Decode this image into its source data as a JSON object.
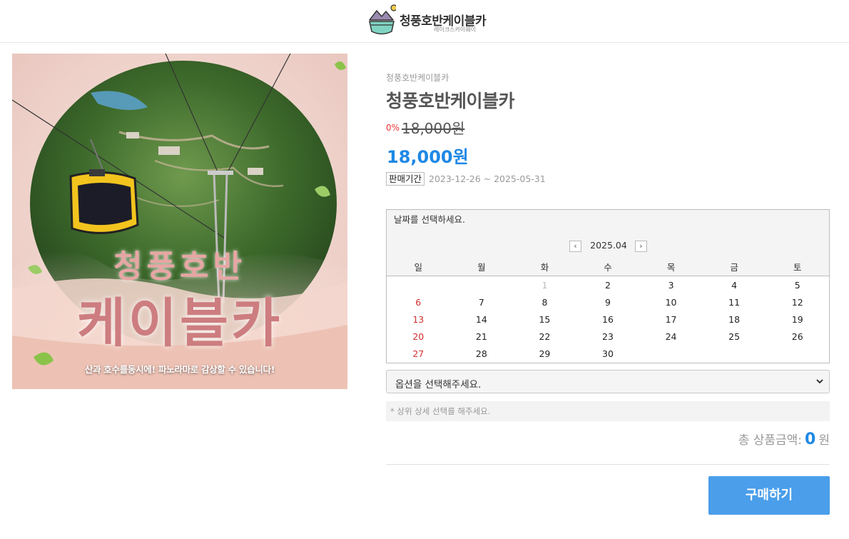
{
  "header": {
    "brand": "청풍호반케이블카",
    "brand_sub": "레이크스카이웨이"
  },
  "product_image": {
    "title_line1": "청풍호반",
    "title_line2": "케이블카",
    "caption": "산과 호수를동시에! 파노라마로 감상할 수 있습니다!"
  },
  "product": {
    "category": "청풍호반케이블카",
    "name": "청풍호반케이블카",
    "discount": "0%",
    "original_price": "18,000원",
    "sale_price": "18,000원",
    "period_label": "판매기간",
    "period_value": "2023-12-26 ~ 2025-05-31"
  },
  "calendar": {
    "prompt": "날짜를 선택하세요.",
    "prev_label": "‹",
    "next_label": "›",
    "month": "2025.04",
    "weekdays": [
      "일",
      "월",
      "화",
      "수",
      "목",
      "금",
      "토"
    ],
    "days": [
      "",
      "",
      "1",
      "2",
      "3",
      "4",
      "5",
      "6",
      "7",
      "8",
      "9",
      "10",
      "11",
      "12",
      "13",
      "14",
      "15",
      "16",
      "17",
      "18",
      "19",
      "20",
      "21",
      "22",
      "23",
      "24",
      "25",
      "26",
      "27",
      "28",
      "29",
      "30",
      "",
      "",
      ""
    ],
    "past_days": [
      "1"
    ]
  },
  "option": {
    "selected": "옵션을 선택해주세요."
  },
  "notice": "* 상위 상세 선택를 해주세요.",
  "total": {
    "label": "총 상품금액:",
    "value": "0",
    "unit": "원"
  },
  "buy_label": "구매하기",
  "colors": {
    "accent": "#1e88e5",
    "button": "#4a9eea",
    "sunday": "#d32f2f"
  }
}
